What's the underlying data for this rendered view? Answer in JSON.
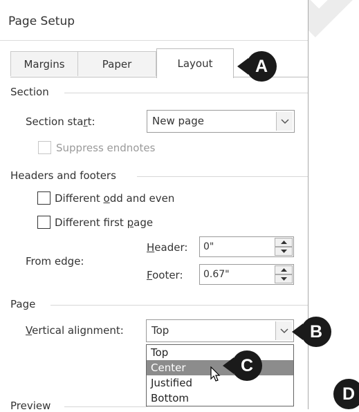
{
  "watermark": "EVALUATION",
  "dialog": {
    "title": "Page Setup",
    "tabs": [
      {
        "label": "Margins"
      },
      {
        "label": "Paper"
      },
      {
        "label": "Layout"
      }
    ]
  },
  "section": {
    "group_label": "Section",
    "section_start_pre": "Section sta",
    "section_start_accel": "r",
    "section_start_post": "t:",
    "section_start_value": "New page",
    "suppress_endnotes_label": "Suppress endnotes"
  },
  "headers_footers": {
    "group_label": "Headers and footers",
    "odd_even_pre": "Different ",
    "odd_even_accel": "o",
    "odd_even_post": "dd and even",
    "first_page_pre": "Different first ",
    "first_page_accel": "p",
    "first_page_post": "age",
    "from_edge_label": "From edge:",
    "header_accel": "H",
    "header_post": "eader:",
    "header_value": "0\"",
    "footer_accel": "F",
    "footer_post": "ooter:",
    "footer_value": "0.67\""
  },
  "page": {
    "group_label": "Page",
    "vertical_alignment_accel": "V",
    "vertical_alignment_post": "ertical alignment:",
    "vertical_alignment_value": "Top",
    "options": [
      "Top",
      "Center",
      "Justified",
      "Bottom"
    ],
    "highlighted_option": "Center"
  },
  "preview": {
    "group_label": "Preview"
  },
  "callouts": {
    "a": "A",
    "b": "B",
    "c": "C",
    "d": "D"
  }
}
